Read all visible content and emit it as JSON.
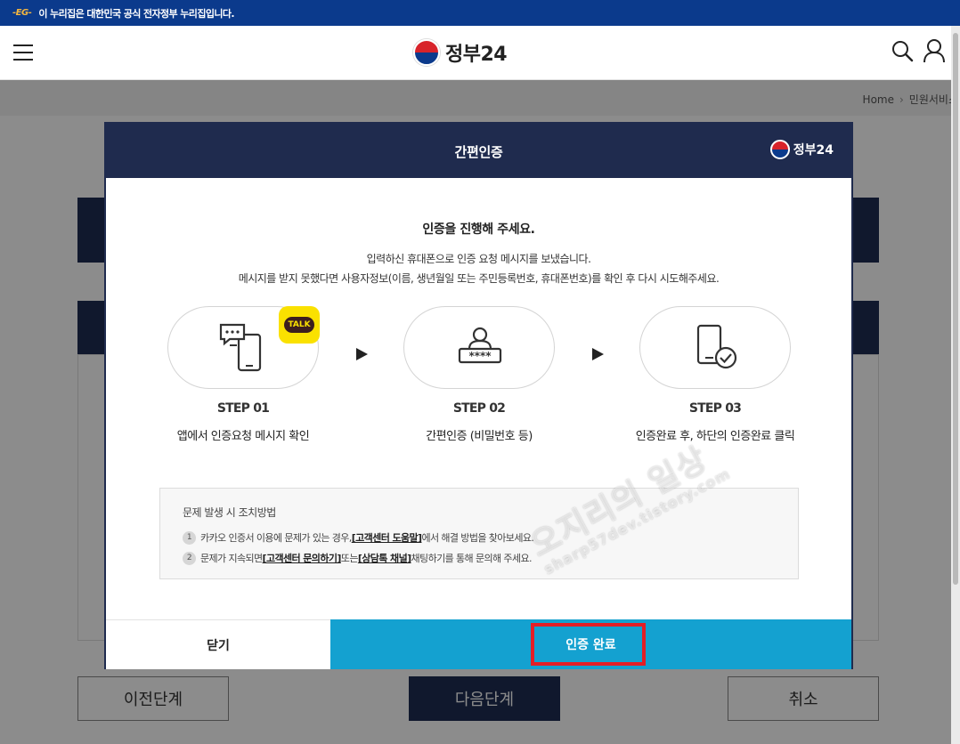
{
  "gov_banner": {
    "mark": "-EG-",
    "text": "이 누리집은 대한민국 공식 전자정부 누리집입니다."
  },
  "header": {
    "logo_text": "정부24",
    "menu_icon": "menu-icon",
    "search_icon": "search-icon",
    "user_icon": "user-icon"
  },
  "breadcrumb": {
    "home": "Home",
    "current": "민원서비스"
  },
  "background_buttons": {
    "prev": "이전단계",
    "next": "다음단계",
    "cancel": "취소"
  },
  "modal": {
    "title": "간편인증",
    "logo_text": "정부24",
    "lead": "인증을 진행해 주세요.",
    "desc_line1": "입력하신 휴대폰으로 인증 요청 메시지를 보냈습니다.",
    "desc_line2": "메시지를 받지 못했다면 사용자정보(이름, 생년월일 또는 주민등록번호, 휴대폰번호)를 확인 후 다시 시도해주세요.",
    "talk_badge": "TALK",
    "steps": [
      {
        "label": "STEP 01",
        "desc": "앱에서 인증요청 메시지 확인",
        "icon": "phone-chat-icon"
      },
      {
        "label": "STEP 02",
        "desc": "간편인증 (비밀번호 등)",
        "icon": "user-password-icon"
      },
      {
        "label": "STEP 03",
        "desc": "인증완료 후, 하단의 인증완료 클릭",
        "icon": "phone-check-icon"
      }
    ],
    "help": {
      "title": "문제 발생 시 조치방법",
      "items": [
        {
          "num": "1",
          "pre": "카카오 인증서 이용에 문제가 있는 경우, ",
          "link": "[고객센터 도움말]",
          "post": " 에서 해결 방법을 찾아보세요."
        },
        {
          "num": "2",
          "pre": "문제가 지속되면 ",
          "link": "[고객센터 문의하기]",
          "mid": " 또는 ",
          "link2": "[상담톡 채널]",
          "post": " 채팅하기를 통해 문의해 주세요."
        }
      ]
    },
    "close_label": "닫기",
    "done_label": "인증 완료"
  },
  "watermark": {
    "line1": "오지리의 일상",
    "line2": "sharp57dev.tistory.com"
  },
  "colors": {
    "navy": "#1f2b4e",
    "banner_blue": "#0b3a8c",
    "action_blue": "#14a1d0",
    "highlight_red": "#e41e26",
    "kakao_yellow": "#fae100"
  }
}
